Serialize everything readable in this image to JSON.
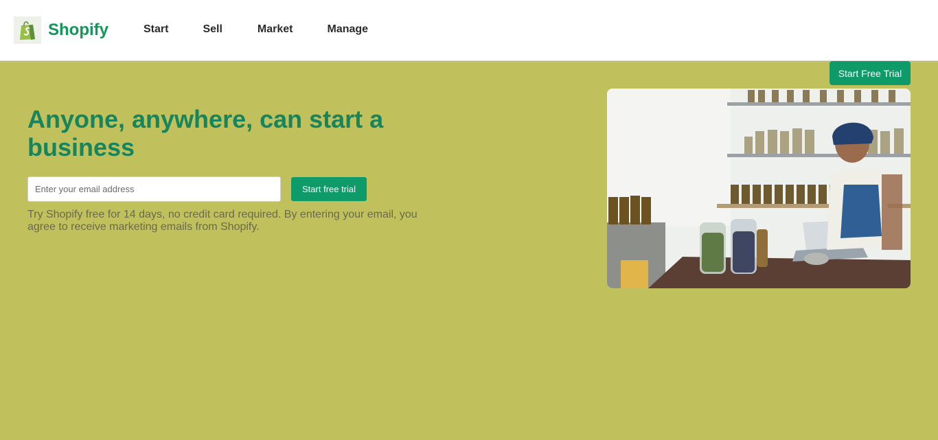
{
  "brand": {
    "name": "Shopify",
    "logo_icon": "shopping-bag-icon"
  },
  "nav": {
    "items": [
      "Start",
      "Sell",
      "Market",
      "Manage"
    ]
  },
  "header_cta": {
    "label": "Start Free Trial"
  },
  "hero": {
    "headline": "Anyone, anywhere, can start a business",
    "email_placeholder": "Enter your email address",
    "submit_label": "Start free trial",
    "disclaimer": "Try Shopify free for 14 days, no credit card required. By entering your email, you agree to receive marketing emails from Shopify."
  },
  "colors": {
    "brand_green": "#14955a",
    "button_green": "#0f9a6a",
    "hero_background": "#c0c05c"
  }
}
